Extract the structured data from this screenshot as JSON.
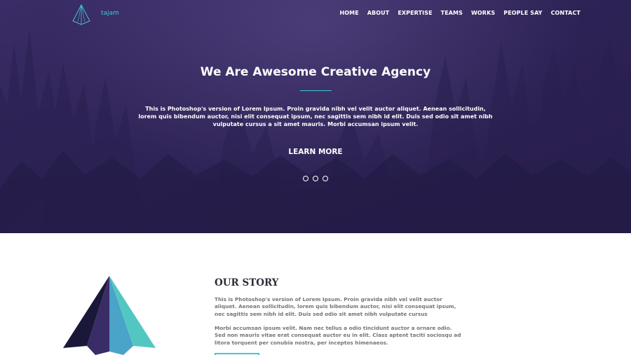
{
  "brand": {
    "name": "tajam",
    "logo_icon": "pyramid-logo-icon",
    "accent_color": "#3fc6d6"
  },
  "nav": {
    "items": [
      "HOME",
      "ABOUT",
      "EXPERTISE",
      "TEAMS",
      "WORKS",
      "PEOPLE SAY",
      "CONTACT"
    ]
  },
  "hero": {
    "title": "We Are Awesome Creative Agency",
    "text": "This is Photoshop's version of Lorem Ipsum. Proin gravida nibh vel velit auctor aliquet. Aenean sollicitudin, lorem quis bibendum auctor, nisi elit consequat ipsum, nec sagittis sem nibh id elit. Duis sed odio sit amet nibh vulputate cursus a sit amet mauris. Morbi accumsan ipsum velit.",
    "cta": "LEARN MORE",
    "slide_count": 3,
    "background_color": "#2e2356"
  },
  "story": {
    "title": "OUR STORY",
    "paragraph_1": "This is Photoshop's version of Lorem Ipsum. Proin gravida nibh vel velit auctor aliquet. Aenean sollicitudin, lorem quis bibendum auctor, nisi elit consequat ipsum, nec sagittis sem nibh id elit. Duis sed odio sit amet nibh vulputate cursus",
    "paragraph_2": "Morbi accumsan ipsum velit. Nam nec tellus a odio tincidunt auctor a ornare odio. Sed non mauris vitae erat consequat auctor eu in elit. Class aptent taciti sociosqu ad litora torquent per conubia nostra, per inceptos himenaeos.",
    "illustration_icon": "pyramid-illustration-icon"
  }
}
